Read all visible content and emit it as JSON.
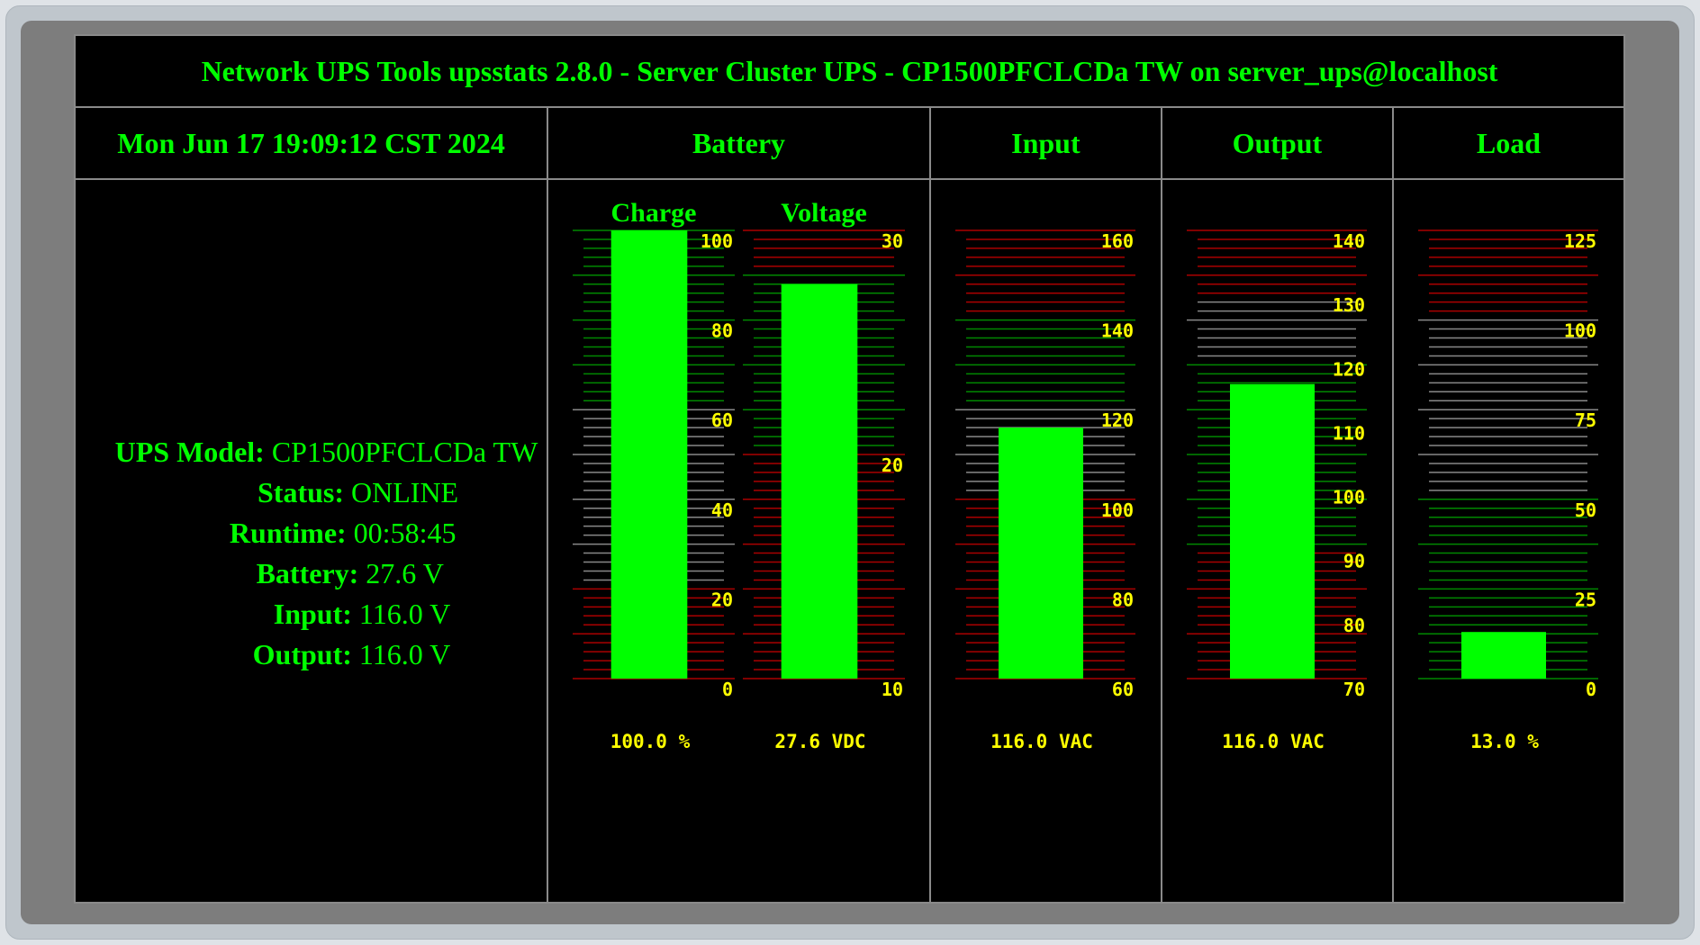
{
  "header": {
    "title": "Network UPS Tools upsstats 2.8.0 - Server Cluster UPS - CP1500PFCLCDa TW on server_ups@localhost",
    "datetime": "Mon Jun 17 19:09:12 CST 2024"
  },
  "columns": {
    "battery": "Battery",
    "input": "Input",
    "output": "Output",
    "load": "Load"
  },
  "info": [
    {
      "key": "UPS Model:",
      "value": "CP1500PFCLCDa TW"
    },
    {
      "key": "Status:",
      "value": "ONLINE"
    },
    {
      "key": "Runtime:",
      "value": "00:58:45"
    },
    {
      "key": "Battery:",
      "value": "27.6 V"
    },
    {
      "key": "Input:",
      "value": "116.0 V"
    },
    {
      "key": "Output:",
      "value": "116.0 V"
    }
  ],
  "colors": {
    "bar": "#00ff00",
    "ok": "#008800",
    "warn": "#888888",
    "crit": "#aa0000",
    "label": "#ffff00",
    "text": "#00ff00"
  },
  "gauges": [
    {
      "id": "charge",
      "label": "Charge",
      "min": 0,
      "max": 100,
      "value": 100,
      "ticks": [
        0,
        20,
        40,
        60,
        80,
        100
      ],
      "value_text": "100.0 %",
      "zones": [
        {
          "from": 0,
          "to": 20,
          "c": "crit"
        },
        {
          "from": 20,
          "to": 60,
          "c": "warn"
        },
        {
          "from": 60,
          "to": 100,
          "c": "ok"
        }
      ]
    },
    {
      "id": "voltage",
      "label": "Voltage",
      "min": 10,
      "max": 30,
      "value": 27.6,
      "ticks": [
        10,
        20,
        30
      ],
      "value_text": "27.6 VDC",
      "zones": [
        {
          "from": 10,
          "to": 20,
          "c": "crit"
        },
        {
          "from": 20,
          "to": 28,
          "c": "ok"
        },
        {
          "from": 28,
          "to": 30,
          "c": "crit"
        }
      ]
    },
    {
      "id": "input",
      "label": "",
      "min": 60,
      "max": 160,
      "value": 116,
      "ticks": [
        60,
        80,
        100,
        120,
        140,
        160
      ],
      "value_text": "116.0 VAC",
      "zones": [
        {
          "from": 60,
          "to": 100,
          "c": "crit"
        },
        {
          "from": 100,
          "to": 120,
          "c": "warn"
        },
        {
          "from": 120,
          "to": 140,
          "c": "ok"
        },
        {
          "from": 140,
          "to": 160,
          "c": "crit"
        }
      ]
    },
    {
      "id": "output",
      "label": "",
      "min": 70,
      "max": 140,
      "value": 116.0,
      "ticks": [
        70,
        80,
        90,
        100,
        110,
        120,
        130,
        140
      ],
      "value_text": "116.0 VAC",
      "zones": [
        {
          "from": 70,
          "to": 90,
          "c": "crit"
        },
        {
          "from": 90,
          "to": 120,
          "c": "ok"
        },
        {
          "from": 120,
          "to": 130,
          "c": "warn"
        },
        {
          "from": 130,
          "to": 140,
          "c": "crit"
        }
      ]
    },
    {
      "id": "load",
      "label": "",
      "min": 0,
      "max": 125,
      "value": 13,
      "ticks": [
        0,
        25,
        50,
        75,
        100,
        125
      ],
      "value_text": "13.0 %",
      "zones": [
        {
          "from": 0,
          "to": 50,
          "c": "ok"
        },
        {
          "from": 50,
          "to": 75,
          "c": "warn"
        },
        {
          "from": 75,
          "to": 100,
          "c": "warn"
        },
        {
          "from": 100,
          "to": 125,
          "c": "crit"
        }
      ]
    }
  ]
}
